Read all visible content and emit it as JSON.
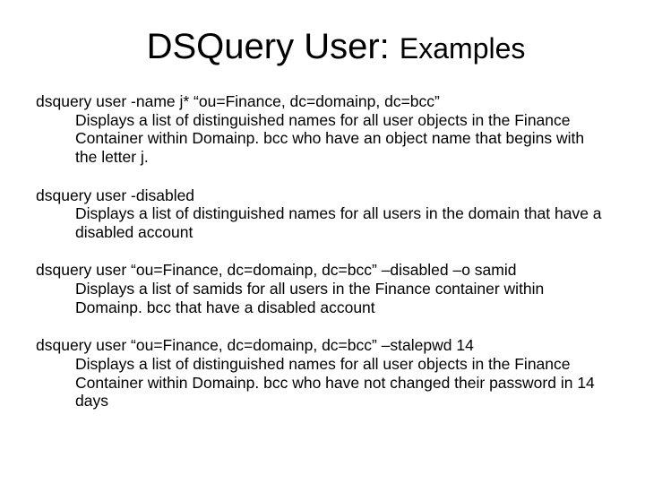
{
  "title": {
    "main": "DSQuery User: ",
    "sub": "Examples"
  },
  "examples": [
    {
      "cmd": "dsquery user -name j*  “ou=Finance, dc=domainp, dc=bcc”",
      "desc": "Displays a list of distinguished names for all user objects in the Finance Container within Domainp. bcc who have an object name that begins with the letter j."
    },
    {
      "cmd": "dsquery user -disabled",
      "desc": "Displays a list of distinguished names for all users in the domain that have a disabled account"
    },
    {
      "cmd": "dsquery user “ou=Finance, dc=domainp, dc=bcc” –disabled –o samid",
      "desc": "Displays a list of samids for all users in the Finance container within Domainp. bcc that have a disabled account"
    },
    {
      "cmd": "dsquery user “ou=Finance, dc=domainp, dc=bcc” –stalepwd 14",
      "desc": "Displays a list of distinguished names for all user objects in the Finance Container within Domainp. bcc who have not changed their password in 14 days"
    }
  ]
}
